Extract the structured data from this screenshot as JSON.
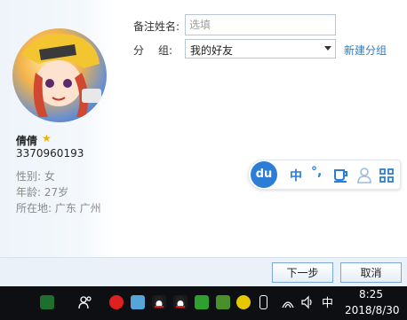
{
  "profile": {
    "nickname": "倩倩",
    "star_icon": "star-icon",
    "qq_number": "3370960193",
    "gender": "性别: 女",
    "age": "年龄: 27岁",
    "location": "所在地: 广东  广州"
  },
  "form": {
    "remark_label": "备注姓名:",
    "remark_placeholder": "选填",
    "remark_value": "",
    "group_label_1": "分",
    "group_label_2": "组:",
    "group_value": "我的好友",
    "new_group_link": "新建分组"
  },
  "ime": {
    "logo": "du",
    "mode": "中",
    "punct": "°,",
    "cup_icon": "cup-icon",
    "user_icon": "user-icon",
    "grid_icon": "grid-icon"
  },
  "buttons": {
    "next": "下一步",
    "cancel": "取消"
  },
  "taskbar": {
    "ime_indicator": "中",
    "time": "8:25",
    "date": "2018/8/30"
  },
  "colors": {
    "link": "#2a7ec8",
    "ime_blue": "#2b7dd6",
    "footer_bg": "#eaf1f8",
    "taskbar_bg": "#0d0f12"
  }
}
